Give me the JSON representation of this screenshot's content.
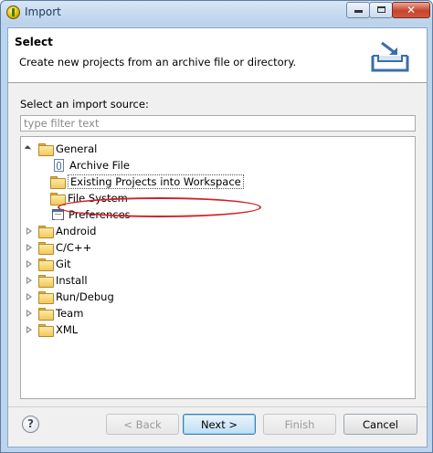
{
  "window": {
    "title": "Import",
    "close_glyph": "✕"
  },
  "header": {
    "title": "Select",
    "description": "Create new projects from an archive file or directory."
  },
  "source": {
    "label": "Select an import source:",
    "filter_placeholder": "type filter text",
    "filter_value": ""
  },
  "tree": {
    "nodes": [
      {
        "label": "General",
        "state": "expanded",
        "icon": "folder-icon"
      },
      {
        "label": "Archive File",
        "icon": "archive-file-icon"
      },
      {
        "label": "Existing Projects into Workspace",
        "icon": "folder-icon",
        "selected": true,
        "annotated": true
      },
      {
        "label": "File System",
        "icon": "folder-icon"
      },
      {
        "label": "Preferences",
        "icon": "preferences-icon"
      },
      {
        "label": "Android",
        "state": "collapsed",
        "icon": "folder-icon"
      },
      {
        "label": "C/C++",
        "state": "collapsed",
        "icon": "folder-icon"
      },
      {
        "label": "Git",
        "state": "collapsed",
        "icon": "folder-icon"
      },
      {
        "label": "Install",
        "state": "collapsed",
        "icon": "folder-icon"
      },
      {
        "label": "Run/Debug",
        "state": "collapsed",
        "icon": "folder-icon"
      },
      {
        "label": "Team",
        "state": "collapsed",
        "icon": "folder-icon"
      },
      {
        "label": "XML",
        "state": "collapsed",
        "icon": "folder-icon"
      }
    ]
  },
  "buttons": {
    "help": "?",
    "back": "< Back",
    "next": "Next >",
    "finish": "Finish",
    "cancel": "Cancel"
  },
  "colors": {
    "annotation": "#d0202a",
    "title_bar": "#bcd4ec"
  }
}
